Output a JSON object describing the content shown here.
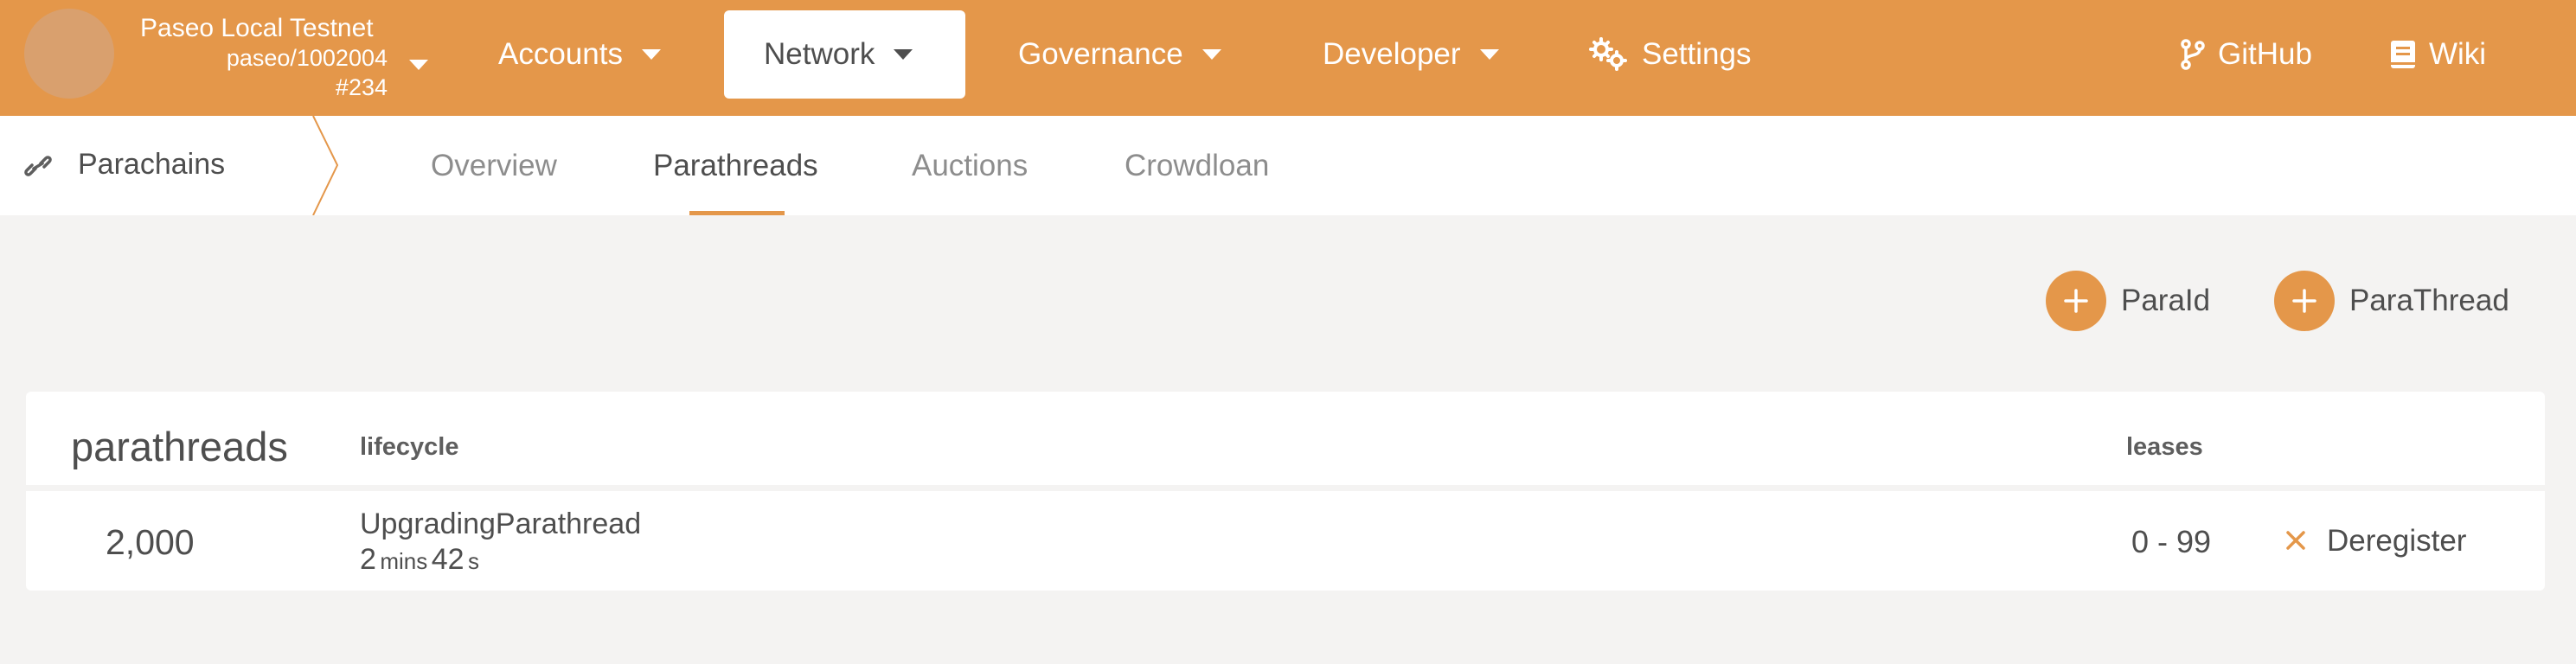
{
  "header": {
    "chain_name": "Paseo Local Testnet",
    "runtime_version": "paseo/1002004",
    "best_block": "#234",
    "nav": [
      {
        "label": "Accounts",
        "active": false
      },
      {
        "label": "Network",
        "active": true
      },
      {
        "label": "Governance",
        "active": false
      },
      {
        "label": "Developer",
        "active": false
      },
      {
        "label": "Settings",
        "icon": "gears-icon"
      }
    ],
    "github_label": "GitHub",
    "wiki_label": "Wiki"
  },
  "subnav": {
    "section_label": "Parachains",
    "section_icon": "link-icon",
    "tabs": [
      "Overview",
      "Parathreads",
      "Auctions",
      "Crowdloan"
    ],
    "active_tab": "Parathreads"
  },
  "actions": {
    "paraid_label": "ParaId",
    "parathread_label": "ParaThread"
  },
  "table": {
    "title": "parathreads",
    "columns": {
      "lifecycle": "lifecycle",
      "leases": "leases"
    },
    "rows": [
      {
        "id": "2,000",
        "lifecycle": "UpgradingParathread",
        "countdown": {
          "minutes": "2",
          "minutes_unit": "mins",
          "seconds": "42",
          "seconds_unit": "s"
        },
        "leases": "0 - 99",
        "action_label": "Deregister",
        "action_icon": "close-icon"
      }
    ]
  },
  "colors": {
    "accent": "#e4974a",
    "background": "#f4f3f2",
    "text": "#4e4e4e",
    "muted": "#8d8d8d"
  }
}
